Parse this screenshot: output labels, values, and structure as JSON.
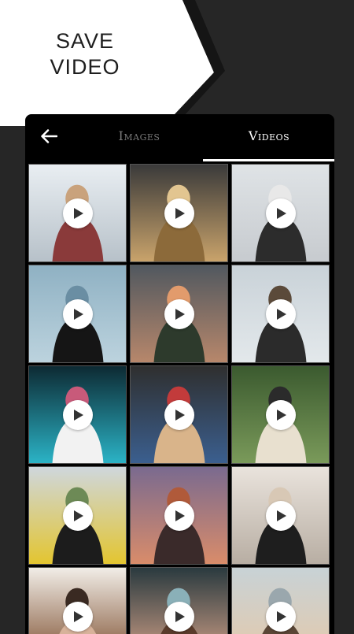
{
  "promo": {
    "line1": "SAVE",
    "line2": "VIDEO"
  },
  "tabs": [
    {
      "label": "Images",
      "active": false
    },
    {
      "label": "Videos",
      "active": true
    }
  ],
  "colors": {
    "background": "#262626",
    "panel": "#000000",
    "promo_shape": "#ffffff",
    "active_tab": "#ffffff",
    "inactive_tab": "#7a7a7a"
  },
  "icons": {
    "back": "arrow-left-icon",
    "play": "play-icon"
  },
  "videos": [
    {
      "palette": [
        "#e9eef2",
        "#b7c1c9",
        "#8a3a3a",
        "#c9a27c"
      ]
    },
    {
      "palette": [
        "#3a3a3a",
        "#c9a36b",
        "#8c6a3a",
        "#e2c590"
      ]
    },
    {
      "palette": [
        "#dfe3e6",
        "#c7cbcf",
        "#2c2c2c",
        "#e8e8e8"
      ]
    },
    {
      "palette": [
        "#8fb1c3",
        "#bcd3de",
        "#151515",
        "#6a8ea3"
      ]
    },
    {
      "palette": [
        "#51585f",
        "#b7876b",
        "#2d3a2c",
        "#e29b6c"
      ]
    },
    {
      "palette": [
        "#c9d2d8",
        "#e3e8eb",
        "#2b2b2b",
        "#5b4a3a"
      ]
    },
    {
      "palette": [
        "#0d2a33",
        "#2bb3c6",
        "#f2f2f2",
        "#c85a7a"
      ]
    },
    {
      "palette": [
        "#2f2f2f",
        "#3b5f8f",
        "#d9b48a",
        "#c23b3b"
      ]
    },
    {
      "palette": [
        "#3b5a2f",
        "#7a9a5a",
        "#e8e0cf",
        "#2b2b2b"
      ]
    },
    {
      "palette": [
        "#cfd7dd",
        "#e3c530",
        "#1c1c1c",
        "#6d8a56"
      ]
    },
    {
      "palette": [
        "#7a6a8f",
        "#d98c6a",
        "#3a2a2a",
        "#b05a3a"
      ]
    },
    {
      "palette": [
        "#e9e3dc",
        "#b8aea3",
        "#1e1e1e",
        "#d8c8b5"
      ]
    },
    {
      "palette": [
        "#f1ede7",
        "#7a4a2a",
        "#d7b29a",
        "#3a2a22"
      ]
    },
    {
      "palette": [
        "#2a3a3f",
        "#d9a58a",
        "#5a3b2b",
        "#8ab0b8"
      ]
    },
    {
      "palette": [
        "#c8d2d6",
        "#e6c9a8",
        "#5a4636",
        "#9aa7ad"
      ]
    }
  ]
}
